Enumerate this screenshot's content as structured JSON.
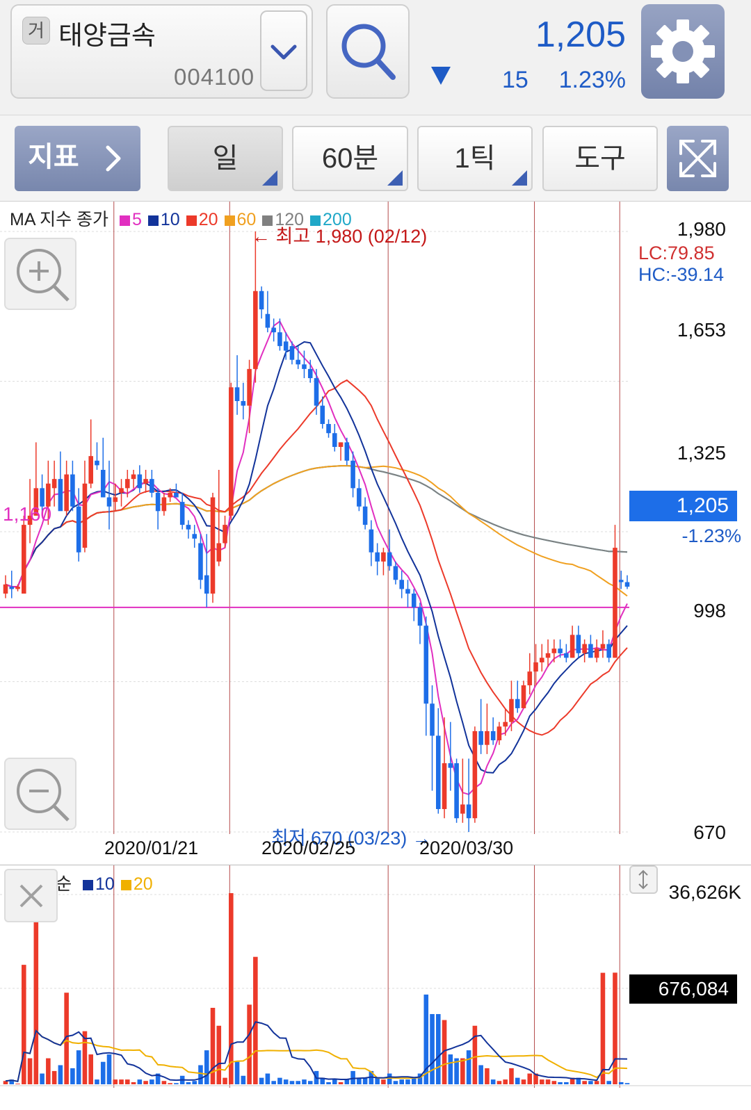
{
  "header": {
    "market_badge": "거",
    "stock_name": "태양금속",
    "stock_code": "004100",
    "price": "1,205",
    "change_value": "15",
    "change_pct": "1.23%",
    "direction": "down",
    "accent_color": "#1e5bc6"
  },
  "toolbar": {
    "indicator_label": "지표",
    "period_day": "일",
    "period_60min": "60분",
    "period_tick": "1틱",
    "tools_label": "도구"
  },
  "icons": [
    "search-icon",
    "gear-icon",
    "chevron-down-icon",
    "chevron-right-icon",
    "expand-icon",
    "zoom-in-icon",
    "zoom-out-icon",
    "close-icon",
    "resize-icon"
  ],
  "price_chart": {
    "legend_title": "MA 지수 종가",
    "ma": [
      {
        "label": "5",
        "color": "#e12fc0"
      },
      {
        "label": "10",
        "color": "#12339a"
      },
      {
        "label": "20",
        "color": "#ec3a2a"
      },
      {
        "label": "60",
        "color": "#f0a020"
      },
      {
        "label": "120",
        "color": "#808080"
      },
      {
        "label": "200",
        "color": "#20a8c8"
      }
    ],
    "high_annotation": "← 최고 1,980 (02/12)",
    "low_annotation": "최저 670 (03/23) →",
    "lc_label": "LC:79.85",
    "hc_label": "HC:-39.14",
    "ref_line_label": "1,160",
    "current_price_label": "1,205",
    "current_pct_label": "-1.23%",
    "y_axis_labels": [
      "1,980",
      "1,653",
      "1,325",
      "998",
      "670"
    ],
    "x_axis_labels": [
      "2020/01/21",
      "2020/02/25",
      "2020/03/30"
    ]
  },
  "volume_chart": {
    "legend_title": "MA 단순",
    "ma": [
      {
        "label": "10",
        "color": "#12339a"
      },
      {
        "label": "20",
        "color": "#f0b000"
      }
    ],
    "max_label": "36,626K",
    "current_label": "676,084"
  },
  "chart_data": {
    "type": "candlestick",
    "ylim": [
      670,
      1980
    ],
    "y_ticks": [
      1980,
      1653,
      1325,
      998,
      670
    ],
    "x_tick_labels": [
      "2020/01/21",
      "2020/02/25",
      "2020/03/30"
    ],
    "high": 1980,
    "high_date": "02/12",
    "low": 670,
    "low_date": "03/23",
    "last_price": 1205,
    "reference_line": 1160,
    "volume_max": "36,626K",
    "volume_last": 676084,
    "candles_ohlc": [
      [
        1190,
        1180,
        1230,
        1210
      ],
      [
        1205,
        1180,
        1240,
        1200
      ],
      [
        1200,
        1195,
        1210,
        1205
      ],
      [
        1190,
        1190,
        1360,
        1340
      ],
      [
        1340,
        1300,
        1440,
        1360
      ],
      [
        1360,
        1360,
        1520,
        1420
      ],
      [
        1420,
        1360,
        1450,
        1380
      ],
      [
        1380,
        1340,
        1480,
        1430
      ],
      [
        1420,
        1380,
        1480,
        1440
      ],
      [
        1440,
        1380,
        1500,
        1370
      ],
      [
        1370,
        1360,
        1480,
        1450
      ],
      [
        1450,
        1370,
        1480,
        1380
      ],
      [
        1380,
        1260,
        1420,
        1280
      ],
      [
        1290,
        1280,
        1480,
        1430
      ],
      [
        1430,
        1420,
        1570,
        1490
      ],
      [
        1480,
        1460,
        1520,
        1470
      ],
      [
        1460,
        1400,
        1530,
        1400
      ],
      [
        1400,
        1330,
        1480,
        1380
      ],
      [
        1390,
        1370,
        1430,
        1400
      ],
      [
        1410,
        1380,
        1440,
        1420
      ],
      [
        1420,
        1400,
        1460,
        1440
      ],
      [
        1440,
        1420,
        1460,
        1450
      ],
      [
        1450,
        1410,
        1470,
        1420
      ],
      [
        1430,
        1410,
        1460,
        1440
      ],
      [
        1440,
        1400,
        1460,
        1410
      ],
      [
        1410,
        1330,
        1420,
        1370
      ],
      [
        1370,
        1360,
        1410,
        1400
      ],
      [
        1400,
        1390,
        1420,
        1410
      ],
      [
        1410,
        1400,
        1430,
        1400
      ],
      [
        1390,
        1330,
        1410,
        1340
      ],
      [
        1340,
        1310,
        1350,
        1330
      ],
      [
        1320,
        1290,
        1340,
        1310
      ],
      [
        1300,
        1200,
        1320,
        1220
      ],
      [
        1230,
        1160,
        1320,
        1190
      ],
      [
        1190,
        1170,
        1410,
        1400
      ],
      [
        1260,
        1250,
        1460,
        1300
      ],
      [
        1300,
        1290,
        1360,
        1340
      ],
      [
        1360,
        1350,
        1650,
        1640
      ],
      [
        1640,
        1580,
        1710,
        1610
      ],
      [
        1610,
        1570,
        1650,
        1600
      ],
      [
        1600,
        1540,
        1700,
        1680
      ],
      [
        1680,
        1650,
        1980,
        1850
      ],
      [
        1850,
        1790,
        1860,
        1810
      ],
      [
        1800,
        1760,
        1850,
        1770
      ],
      [
        1770,
        1740,
        1790,
        1760
      ],
      [
        1760,
        1720,
        1790,
        1730
      ],
      [
        1740,
        1700,
        1760,
        1720
      ],
      [
        1730,
        1690,
        1740,
        1700
      ],
      [
        1700,
        1680,
        1730,
        1690
      ],
      [
        1690,
        1660,
        1720,
        1680
      ],
      [
        1680,
        1650,
        1700,
        1660
      ],
      [
        1660,
        1580,
        1680,
        1600
      ],
      [
        1600,
        1550,
        1620,
        1560
      ],
      [
        1560,
        1530,
        1570,
        1540
      ],
      [
        1540,
        1500,
        1560,
        1510
      ],
      [
        1510,
        1480,
        1520,
        1520
      ],
      [
        1520,
        1470,
        1530,
        1480
      ],
      [
        1480,
        1400,
        1500,
        1420
      ],
      [
        1420,
        1370,
        1440,
        1380
      ],
      [
        1380,
        1330,
        1400,
        1340
      ],
      [
        1330,
        1250,
        1350,
        1280
      ],
      [
        1280,
        1230,
        1300,
        1260
      ],
      [
        1260,
        1230,
        1290,
        1280
      ],
      [
        1280,
        1240,
        1330,
        1250
      ],
      [
        1250,
        1210,
        1260,
        1220
      ],
      [
        1220,
        1180,
        1240,
        1200
      ],
      [
        1200,
        1160,
        1220,
        1190
      ],
      [
        1190,
        1130,
        1200,
        1160
      ],
      [
        1160,
        1080,
        1170,
        1120
      ],
      [
        1120,
        880,
        1140,
        950
      ],
      [
        950,
        760,
        990,
        880
      ],
      [
        880,
        710,
        940,
        720
      ],
      [
        720,
        700,
        920,
        820
      ],
      [
        820,
        760,
        910,
        810
      ],
      [
        820,
        690,
        830,
        700
      ],
      [
        710,
        690,
        830,
        730
      ],
      [
        730,
        670,
        830,
        700
      ],
      [
        700,
        690,
        900,
        890
      ],
      [
        890,
        840,
        960,
        860
      ],
      [
        860,
        840,
        950,
        890
      ],
      [
        890,
        860,
        920,
        870
      ],
      [
        870,
        860,
        910,
        900
      ],
      [
        900,
        880,
        940,
        910
      ],
      [
        910,
        890,
        1000,
        960
      ],
      [
        960,
        930,
        1000,
        940
      ],
      [
        940,
        940,
        1000,
        990
      ],
      [
        990,
        970,
        1060,
        1020
      ],
      [
        1020,
        990,
        1080,
        1040
      ],
      [
        1040,
        1020,
        1080,
        1050
      ],
      [
        1050,
        1030,
        1090,
        1060
      ],
      [
        1060,
        1040,
        1090,
        1070
      ],
      [
        1070,
        1050,
        1090,
        1060
      ],
      [
        1060,
        1040,
        1080,
        1050
      ],
      [
        1050,
        1050,
        1120,
        1100
      ],
      [
        1100,
        1050,
        1120,
        1060
      ],
      [
        1060,
        1040,
        1090,
        1080
      ],
      [
        1080,
        1050,
        1100,
        1050
      ],
      [
        1050,
        1040,
        1090,
        1070
      ],
      [
        1070,
        1050,
        1110,
        1080
      ],
      [
        1080,
        1040,
        1090,
        1050
      ],
      [
        1050,
        1050,
        1340,
        1290
      ],
      [
        1220,
        1200,
        1240,
        1215
      ],
      [
        1215,
        1200,
        1230,
        1205
      ]
    ]
  }
}
